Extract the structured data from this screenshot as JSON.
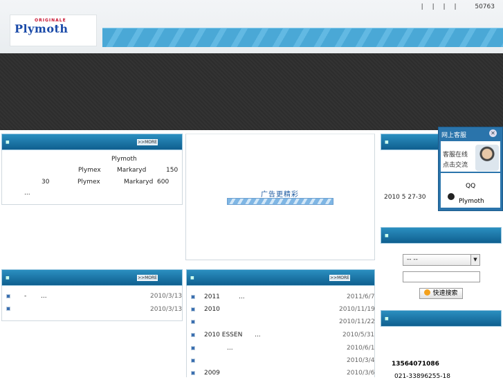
{
  "header": {
    "logo_top": "ORIGINALE",
    "logo_brand": "Plymoth",
    "links": [
      "|",
      "|",
      "|",
      "|"
    ],
    "visit_count": "50763"
  },
  "intro": {
    "more_label": ">>MORE",
    "line1": "Plymoth",
    "line2_a": "Plymex",
    "line2_b": "Markaryd",
    "line2_c": "150",
    "line3_a": "30",
    "line3_b": "Plymex",
    "line3_c": "Markaryd",
    "line3_d": "600",
    "ellipsis": "..."
  },
  "ad": {
    "text": "广告更精彩"
  },
  "sidebar_top": {
    "text": "2010 5 27-30"
  },
  "chat": {
    "title": "网上客服",
    "close": "✕",
    "line1": "客服在线",
    "line2": "点击交流",
    "qq_label": "QQ",
    "name": "Plymoth"
  },
  "news_left": {
    "more_label": ">>MORE",
    "items": [
      {
        "a": "-",
        "b": "...",
        "date": "2010/3/13"
      },
      {
        "a": "",
        "b": "",
        "date": "2010/3/13"
      }
    ]
  },
  "news_mid": {
    "more_label": ">>MORE",
    "items": [
      {
        "a": "2011",
        "b": "...",
        "date": "2011/6/7"
      },
      {
        "a": "2010",
        "b": "",
        "date": "2010/11/19"
      },
      {
        "a": "",
        "b": "",
        "date": "2010/11/22"
      },
      {
        "a": "2010  ESSEN",
        "b": "...",
        "date": "2010/5/31"
      },
      {
        "a": "",
        "b": "...",
        "date": "2010/6/1"
      },
      {
        "a": "",
        "b": "",
        "date": "2010/3/4"
      },
      {
        "a": "2009",
        "b": "",
        "date": "2010/3/6"
      }
    ]
  },
  "search": {
    "select_value": "--   --",
    "button_label": "快速搜索"
  },
  "contact": {
    "mobile": "13564071086",
    "phone": "021-33896255-18"
  }
}
